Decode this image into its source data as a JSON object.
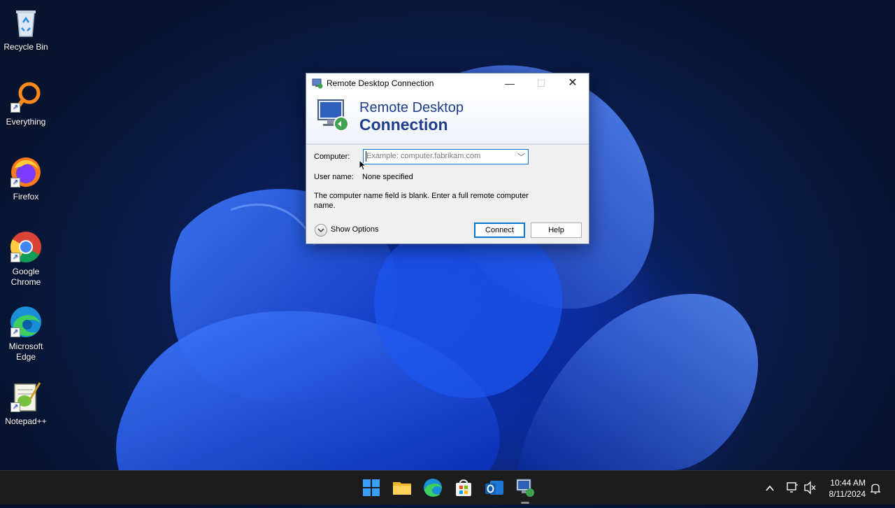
{
  "desktop": {
    "icons": [
      {
        "label": "Recycle Bin"
      },
      {
        "label": "Everything"
      },
      {
        "label": "Firefox"
      },
      {
        "label": "Google Chrome"
      },
      {
        "label": "Microsoft Edge"
      },
      {
        "label": "Notepad++"
      }
    ]
  },
  "dialog": {
    "title": "Remote Desktop Connection",
    "banner_line1": "Remote Desktop",
    "banner_line2": "Connection",
    "computer_label": "Computer:",
    "computer_placeholder": "Example: computer.fabrikam.com",
    "computer_value": "",
    "username_label": "User name:",
    "username_value": "None specified",
    "message": "The computer name field is blank. Enter a full remote computer name.",
    "show_options": "Show Options",
    "connect_label": "Connect",
    "help_label": "Help",
    "controls": {
      "minimize": "minimize-icon",
      "maximize": "maximize-icon",
      "close": "close-icon"
    }
  },
  "taskbar": {
    "apps": [
      "start-icon",
      "file-explorer-icon",
      "edge-icon",
      "store-icon",
      "outlook-icon",
      "remote-desktop-icon"
    ],
    "clock_time": "10:44 AM",
    "clock_date": "8/11/2024"
  },
  "colors": {
    "taskbar_bg": "#1c1c1c",
    "banner_text": "#1f3d8a",
    "focus_accent": "#0078d4"
  }
}
